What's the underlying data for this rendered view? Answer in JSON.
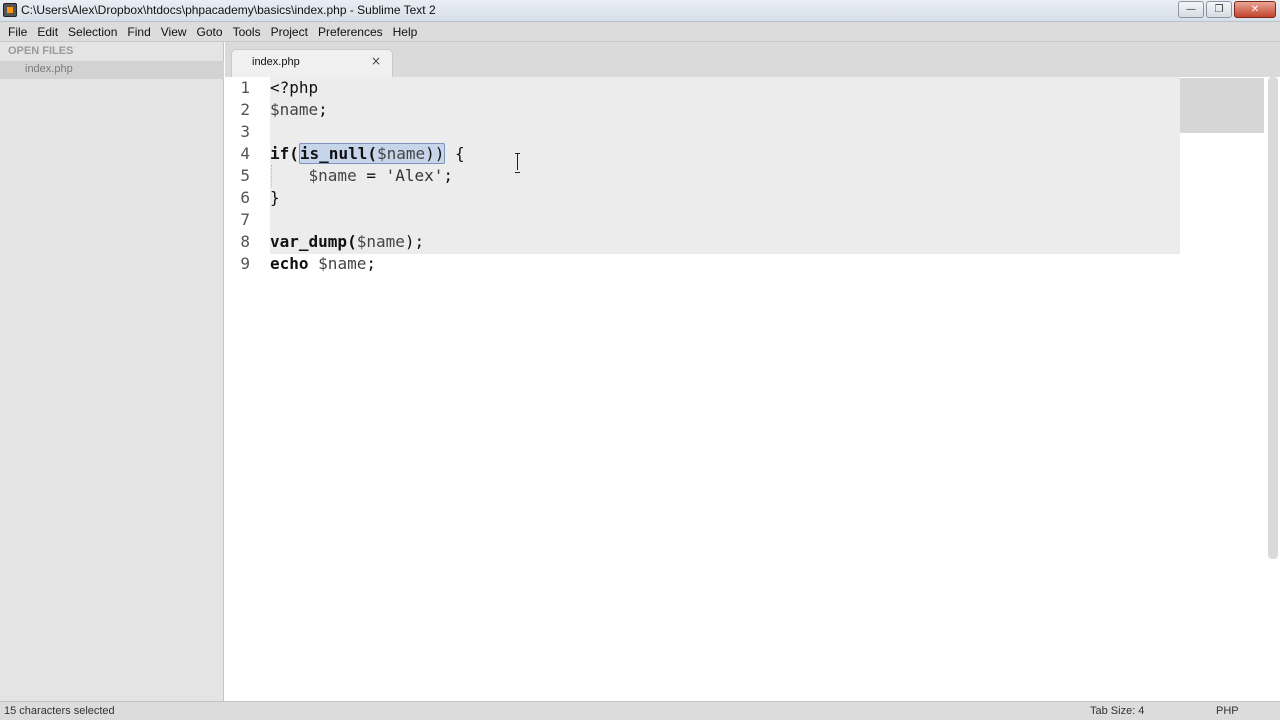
{
  "window": {
    "title": "C:\\Users\\Alex\\Dropbox\\htdocs\\phpacademy\\basics\\index.php - Sublime Text 2",
    "minimize_glyph": "—",
    "maximize_glyph": "❐",
    "close_glyph": "✕"
  },
  "menu": [
    "File",
    "Edit",
    "Selection",
    "Find",
    "View",
    "Goto",
    "Tools",
    "Project",
    "Preferences",
    "Help"
  ],
  "sidebar": {
    "header": "OPEN FILES",
    "files": [
      "index.php"
    ]
  },
  "tabs": [
    {
      "label": "index.php",
      "close": "×",
      "active": true
    }
  ],
  "editor": {
    "line_numbers": [
      "1",
      "2",
      "3",
      "4",
      "5",
      "6",
      "7",
      "8",
      "9"
    ],
    "lines": {
      "l1": "<?php",
      "l2_var": "$name",
      "l2_end": ";",
      "l4_kw": "if(",
      "l4_sel_fn": "is_null(",
      "l4_sel_var": "$name",
      "l4_sel_close": "))",
      "l4_end": " {",
      "l5_indent": "    ",
      "l5_var": "$name",
      "l5_op": " = ",
      "l5_str": "'Alex'",
      "l5_end": ";",
      "l6": "}",
      "l8_fn": "var_dump(",
      "l8_var": "$name",
      "l8_end": ");",
      "l9_kw": "echo",
      "l9_sp": " ",
      "l9_var": "$name",
      "l9_end": ";"
    }
  },
  "statusbar": {
    "selection": "15 characters selected",
    "tab_size": "Tab Size: 4",
    "syntax": "PHP"
  },
  "colors": {
    "selection_bg": "#c7d5ea",
    "selection_border": "#7d95bf",
    "current_block_bg": "#ececec"
  }
}
